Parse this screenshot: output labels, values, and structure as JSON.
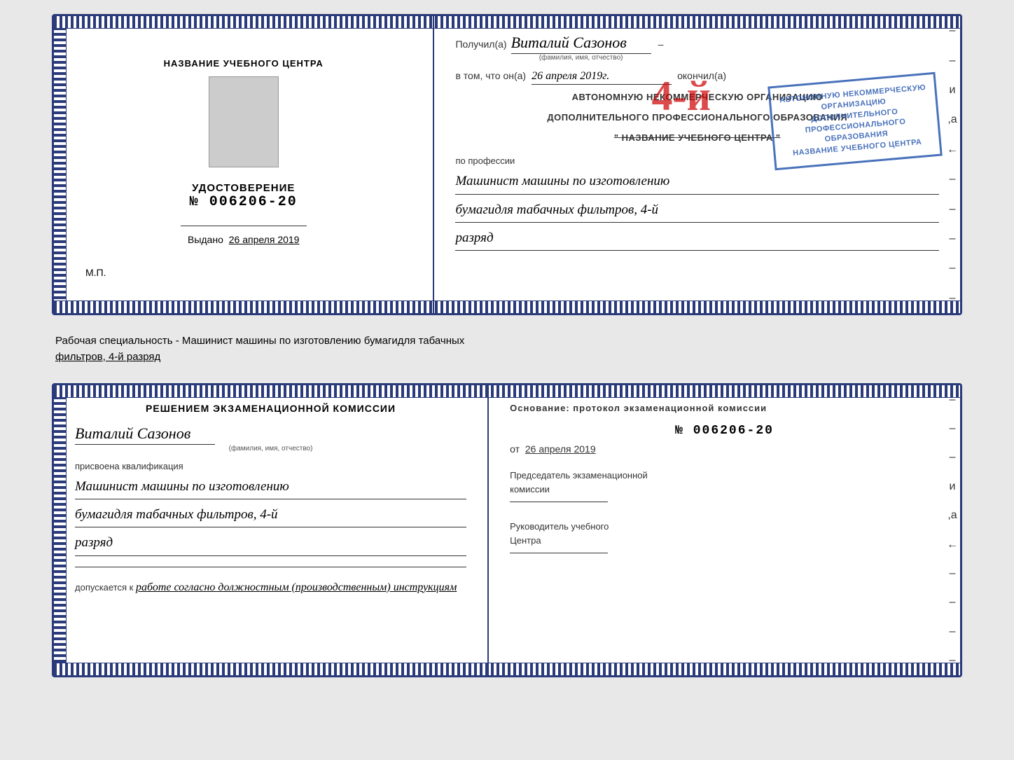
{
  "page": {
    "background": "#e8e8e8"
  },
  "topCert": {
    "left": {
      "org_name_label": "НАЗВАНИЕ УЧЕБНОГО ЦЕНТРА",
      "title_label": "УДОСТОВЕРЕНИЕ",
      "number": "№ 006206-20",
      "issued_label": "Выдано",
      "issued_date": "26 апреля 2019",
      "mp_label": "М.П."
    },
    "right": {
      "recipient_prefix": "Получил(а)",
      "recipient_name": "Виталий Сазонов",
      "recipient_sub": "(фамилия, имя, отчество)",
      "dash": "–",
      "in_that_prefix": "в том, что он(а)",
      "date_handwritten": "26 апреля 2019г.",
      "finished_label": "окончил(а)",
      "org_type_line1": "АВТОНОМНУЮ НЕКОММЕРЧЕСКУЮ ОРГАНИЗАЦИЮ",
      "org_type_line2": "ДОПОЛНИТЕЛЬНОГО ПРОФЕССИОНАЛЬНОГО ОБРАЗОВАНИЯ",
      "org_name_quoted": "\" НАЗВАНИЕ УЧЕБНОГО ЦЕНТРА \"",
      "profession_label": "по профессии",
      "profession_line1": "Машинист машины по изготовлению",
      "profession_line2": "бумагидля табачных фильтров, 4-й",
      "profession_line3": "разряд"
    },
    "stamp": {
      "line1": "АВТОНОМНУЮ НЕКОММЕРЧЕСКУЮ",
      "line2": "ОРГАНИЗАЦИЮ ДОПОЛНИТЕЛЬНОГО",
      "line3": "ПРОФЕССИОНАЛЬНОГО ОБРАЗОВАНИЯ",
      "line4": "НАЗВАНИЕ УЧЕБНОГО ЦЕНТРА"
    },
    "red_number": "4-й"
  },
  "infoText": {
    "line1": "Рабочая специальность - Машинист машины по изготовлению бумагидля табачных",
    "line2": "фильтров, 4-й разряд"
  },
  "bottomCert": {
    "left": {
      "decision_title": "Решением экзаменационной комиссии",
      "person_name": "Виталий Сазонов",
      "person_sub": "(фамилия, имя, отчество)",
      "assigned_label": "присвоена квалификация",
      "qualification_line1": "Машинист машины по изготовлению",
      "qualification_line2": "бумагидля табачных фильтров, 4-й",
      "qualification_line3": "разряд",
      "admission_label": "допускается к",
      "admission_text": "работе согласно должностным (производственным) инструкциям"
    },
    "right": {
      "basis_label": "Основание: протокол экзаменационной комиссии",
      "protocol_number": "№ 006206-20",
      "date_prefix": "от",
      "date_value": "26 апреля 2019",
      "chairman_label": "Председатель экзаменационной",
      "chairman_label2": "комиссии",
      "head_label": "Руководитель учебного",
      "head_label2": "Центра"
    }
  }
}
